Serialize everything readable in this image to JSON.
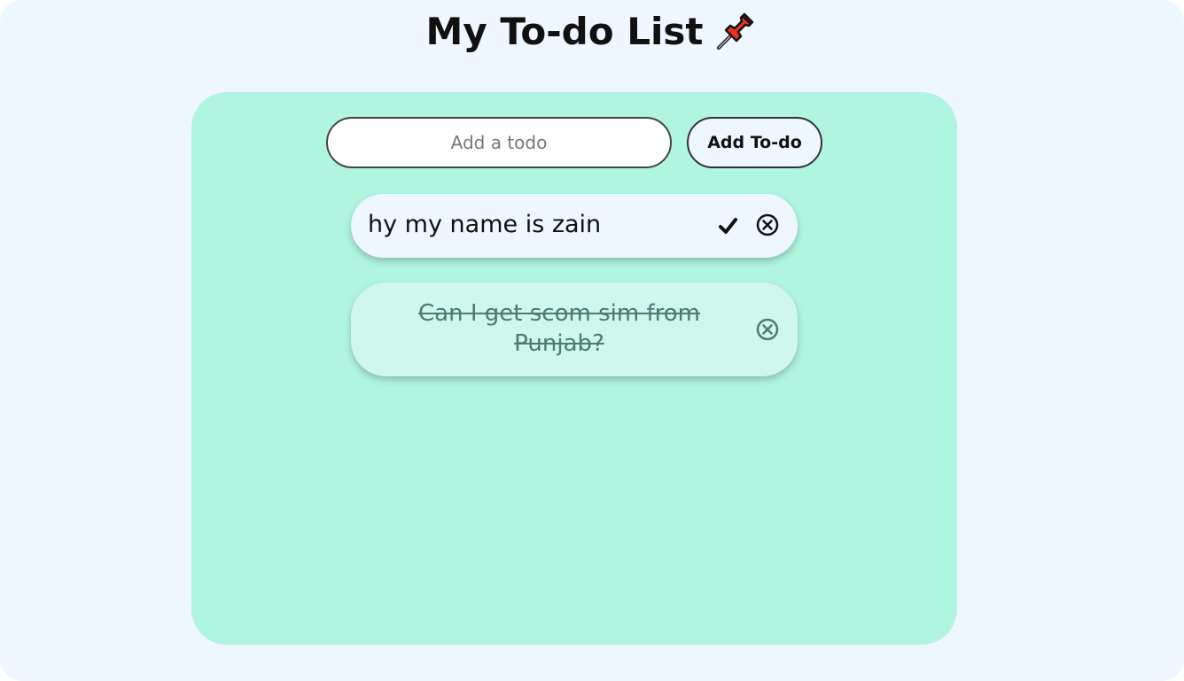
{
  "app": {
    "title": "My To-do List",
    "title_icon": "pushpin-icon"
  },
  "form": {
    "input_placeholder": "Add a todo",
    "input_value": "",
    "add_button_label": "Add To-do"
  },
  "todos": [
    {
      "text": "hy my name is zain",
      "completed": false,
      "actions": [
        "check-icon",
        "close-circle-icon"
      ]
    },
    {
      "text": "Can I get scom sim from Punjab?",
      "completed": true,
      "actions": [
        "close-circle-icon"
      ]
    }
  ],
  "colors": {
    "page_background": "#eef6ff",
    "panel_background": "#b0f5e0",
    "completed_item_background": "#cff7ee",
    "completed_text": "#4f7a6e",
    "pin_red": "#e8321e"
  }
}
